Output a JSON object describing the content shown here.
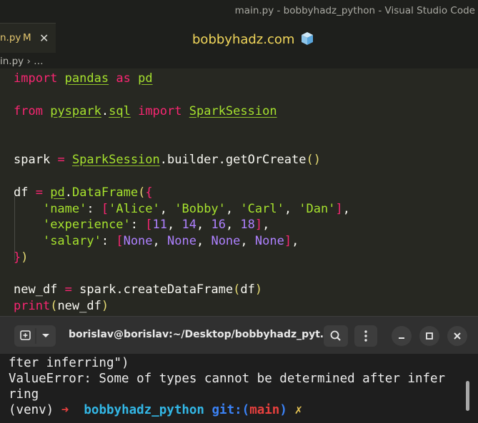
{
  "window": {
    "title": "main.py - bobbyhadz_python - Visual Studio Code"
  },
  "tab": {
    "filename": "main.py",
    "visible_name": "n.py",
    "modified_marker": "M",
    "close_glyph": "✕"
  },
  "watermark": {
    "text": "bobbyhadz.com",
    "icon": "ice-cube-icon"
  },
  "breadcrumb": {
    "file": "in.py",
    "separator": "›",
    "trail": "…"
  },
  "code": {
    "l1": {
      "kw_import": "import",
      "mod": "pandas",
      "kw_as": "as",
      "alias": "pd"
    },
    "l2": {
      "kw_from": "from",
      "mod1": "pyspark",
      "dot": ".",
      "mod2": "sql",
      "kw_import": "import",
      "cls": "SparkSession"
    },
    "l3": {
      "var": "spark",
      "eq": "=",
      "cls": "SparkSession",
      "rest": ".builder.getOrCreate",
      "open": "(",
      "close": ")"
    },
    "l4": {
      "var": "df",
      "eq": "=",
      "mod": "pd",
      "dot": ".",
      "cls": "DataFrame",
      "open_paren": "(",
      "open_brace": "{"
    },
    "l5": {
      "key": "'name'",
      "colon": ": ",
      "open": "[",
      "items": [
        "'Alice'",
        "'Bobby'",
        "'Carl'",
        "'Dan'"
      ],
      "close": "]",
      "trail": ","
    },
    "l6": {
      "key": "'experience'",
      "colon": ": ",
      "open": "[",
      "items": [
        "11",
        "14",
        "16",
        "18"
      ],
      "close": "]",
      "trail": ","
    },
    "l7": {
      "key": "'salary'",
      "colon": ": ",
      "open": "[",
      "items": [
        "None",
        "None",
        "None",
        "None"
      ],
      "close": "]",
      "trail": ","
    },
    "l8": {
      "close_brace": "}",
      "close_paren": ")"
    },
    "l9": {
      "var": "new_df",
      "eq": "=",
      "rest": "spark.createDataFrame",
      "open": "(",
      "arg": "df",
      "close": ")"
    },
    "l10": {
      "fn": "print",
      "open": "(",
      "arg": "new_df",
      "close": ")"
    }
  },
  "terminal": {
    "title": "borislav@borislav:~/Desktop/bobbyhadz_pyt…",
    "lines": {
      "l1": "fter inferring\")",
      "l2": "ValueError: Some of types cannot be determined after infer",
      "l3": "ring"
    },
    "prompt": {
      "venv": "(venv)",
      "arrow": "➜",
      "dir": "bobbyhadz_python",
      "git": "git:(",
      "branch": "main",
      "git_close": ")",
      "dirty": "✗"
    },
    "icons": {
      "new_tab": "new-tab-icon",
      "dropdown": "chevron-down-icon",
      "search": "search-icon",
      "menu": "kebab-menu-icon",
      "minimize": "minimize-icon",
      "maximize": "maximize-icon",
      "close": "close-icon"
    }
  },
  "colors": {
    "editor_bg": "#272822",
    "keyword": "#f92672",
    "function": "#a6e22e",
    "string": "#a6e22e",
    "number": "#ae81ff",
    "watermark": "#f2d75b",
    "terminal_bg": "#1e1e1e"
  }
}
